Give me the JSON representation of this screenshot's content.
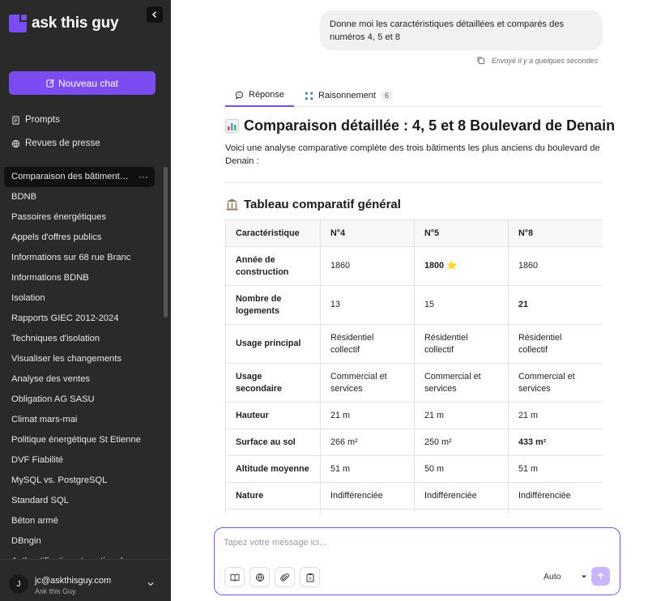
{
  "app": {
    "name": "ask this guy"
  },
  "sidebar": {
    "new_chat_label": "Nouveau chat",
    "links": [
      {
        "label": "Prompts",
        "icon": "document-icon"
      },
      {
        "label": "Revues de presse",
        "icon": "globe-icon"
      }
    ],
    "history": [
      "Comparaison des bâtiments d...",
      "BDNB",
      "Passoires énergétiques",
      "Appels d'offres publics",
      "Informations sur 68 rue Branc",
      "Informations BDNB",
      "Isolation",
      "Rapports GIEC 2012-2024",
      "Techniques d'isolation",
      "Visualiser les changements",
      "Analyse des ventes",
      "Obligation AG SASU",
      "Climat mars-mai",
      "Politique énergétique St Etienne",
      "DVF Fiabilité",
      "MySQL vs. PostgreSQL",
      "Standard SQL",
      "Béton armé",
      "DBngin",
      "Authentification et gestion d..."
    ],
    "active_more": "···",
    "user": {
      "initial": "J",
      "email": "jc@askthisguy.com",
      "subtitle": "Ask this Guy"
    }
  },
  "chat": {
    "user_message": "Donne moi les caractéristiques détaillées et comparés des numéros 4, 5 et 8",
    "sent_status": "Envoyé il y a quelques secondes",
    "tabs": [
      {
        "label": "Réponse"
      },
      {
        "label": "Raisonnement",
        "badge": "6"
      }
    ],
    "title": "Comparaison détaillée : 4, 5 et 8 Boulevard de Denain",
    "intro": "Voici une analyse comparative complète des trois bâtiments les plus anciens du boulevard de Denain :",
    "section_title": "Tableau comparatif général",
    "table": {
      "headers": [
        "Caractéristique",
        "N°4",
        "N°5",
        "N°8"
      ],
      "rows": [
        [
          "Année de construction",
          "1860",
          "1800 ⭐",
          "1860"
        ],
        [
          "Nombre de logements",
          "13",
          "15",
          "21"
        ],
        [
          "Usage principal",
          "Résidentiel collectif",
          "Résidentiel collectif",
          "Résidentiel collectif"
        ],
        [
          "Usage secondaire",
          "Commercial et services",
          "Commercial et services",
          "Commercial et services"
        ],
        [
          "Hauteur",
          "21 m",
          "21 m",
          "21 m"
        ],
        [
          "Surface au sol",
          "266 m²",
          "250 m²",
          "433 m²"
        ],
        [
          "Altitude moyenne",
          "51 m",
          "50 m",
          "51 m"
        ],
        [
          "Nature",
          "Indifférenciée",
          "Indifférenciée",
          "Indifférenciée"
        ],
        [
          "",
          "",
          "",
          ""
        ]
      ]
    }
  },
  "composer": {
    "placeholder": "Tapez votre message ici...",
    "model": "Auto"
  },
  "colors": {
    "accent": "#7b4cf2",
    "sidebar_bg": "#2a2a2a"
  }
}
